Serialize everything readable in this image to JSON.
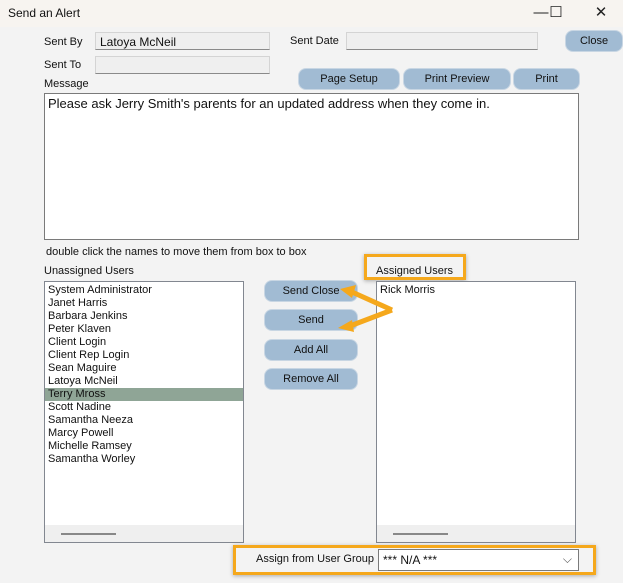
{
  "window": {
    "title": "Send an Alert",
    "minimize": "—",
    "maximize": "☐",
    "close": "✕"
  },
  "form": {
    "sent_by_label": "Sent By",
    "sent_by_value": "Latoya McNeil",
    "sent_date_label": "Sent Date",
    "sent_date_value": "",
    "sent_to_label": "Sent To",
    "sent_to_value": "",
    "message_label": "Message",
    "message_value": "Please ask Jerry Smith's parents for an updated address when they come in.",
    "hint": "double click the names to move them from box to box"
  },
  "toolbar": {
    "close": "Close",
    "page_setup": "Page Setup",
    "print_preview": "Print Preview",
    "print": "Print"
  },
  "unassigned": {
    "label": "Unassigned Users",
    "items": [
      "System Administrator",
      "Janet Harris",
      "Barbara Jenkins",
      "Peter Klaven",
      "Client Login",
      "Client Rep Login",
      "Sean Maguire",
      "Latoya McNeil",
      "Terry Mross",
      "Scott Nadine",
      "Samantha  Neeza",
      "Marcy Powell",
      "Michelle Ramsey",
      "Samantha Worley"
    ],
    "selected": "Terry Mross"
  },
  "actions": {
    "send_close": "Send  Close",
    "send": "Send",
    "add_all": "Add All",
    "remove_all": "Remove All"
  },
  "assigned": {
    "label": "Assigned Users",
    "items": [
      "Rick Morris"
    ]
  },
  "group": {
    "label": "Assign from User Group",
    "value": "*** N/A ***",
    "chevron": "⌵"
  },
  "colors": {
    "button": "#a1bbd3",
    "selection": "#8fa596",
    "annotation": "#f5a81c"
  }
}
